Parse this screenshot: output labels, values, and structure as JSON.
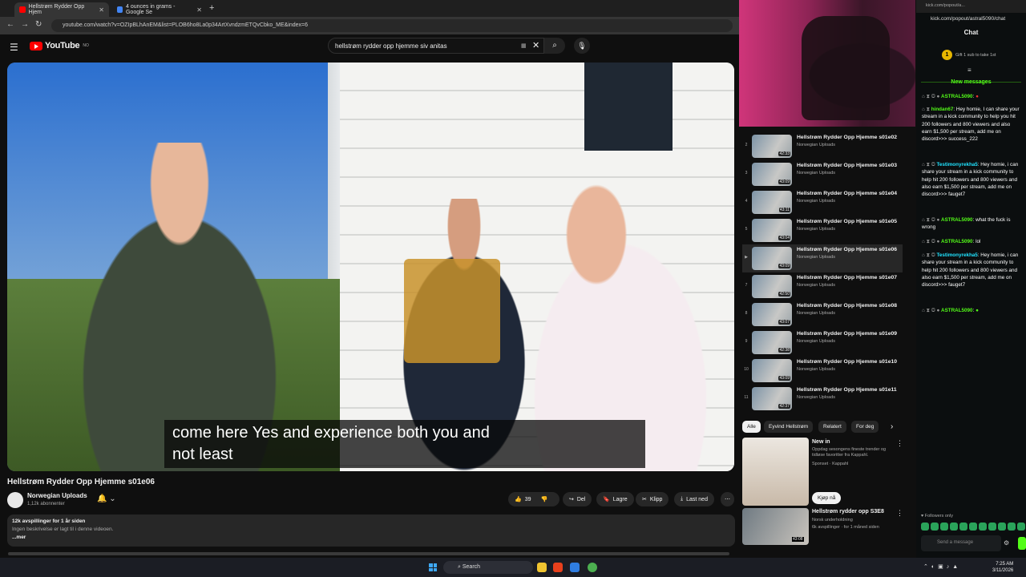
{
  "browser": {
    "tabs": [
      {
        "title": "Hellstrøm Rydder Opp Hjem",
        "active": true
      },
      {
        "title": "4 ounces in grams - Google Se",
        "active": false
      }
    ],
    "url": "youtube.com/watch?v=OZIpBLhAnEM&list=PLOB6ho8La0p34ArtXvndzmETQvCbko_ME&index=6"
  },
  "youtube": {
    "logo_text": "YouTube",
    "logo_region": "NO",
    "search_value": "hellstrøm rydder opp hjemme siv anitas",
    "caption_line1": "come here Yes and experience both you and",
    "caption_line2": "not least",
    "video_title": "Hellstrøm Rydder Opp Hjemme s01e06",
    "channel_name": "Norwegian Uploads",
    "subscribers": "1,12k abonnenter",
    "actions": {
      "likes": "39",
      "share": "Del",
      "save": "Lagre",
      "clip": "Klipp",
      "download": "Last ned"
    },
    "description": {
      "views": "12k avspillinger  for 1 år siden",
      "note": "Ingen beskrivelse er lagt til i denne videoen.",
      "more": "...mer"
    },
    "playlist": [
      {
        "idx": "2",
        "title": "Hellstrøm Rydder Opp Hjemme s01e02",
        "channel": "Norwegian Uploads",
        "duration": "42:33",
        "active": false
      },
      {
        "idx": "3",
        "title": "Hellstrøm Rydder Opp Hjemme s01e03",
        "channel": "Norwegian Uploads",
        "duration": "43:09",
        "active": false
      },
      {
        "idx": "4",
        "title": "Hellstrøm Rydder Opp Hjemme s01e04",
        "channel": "Norwegian Uploads",
        "duration": "43:11",
        "active": false
      },
      {
        "idx": "5",
        "title": "Hellstrøm Rydder Opp Hjemme s01e05",
        "channel": "Norwegian Uploads",
        "duration": "43:04",
        "active": false
      },
      {
        "idx": "▶",
        "title": "Hellstrøm Rydder Opp Hjemme s01e06",
        "channel": "Norwegian Uploads",
        "duration": "43:09",
        "active": true
      },
      {
        "idx": "7",
        "title": "Hellstrøm Rydder Opp Hjemme s01e07",
        "channel": "Norwegian Uploads",
        "duration": "42:50",
        "active": false
      },
      {
        "idx": "8",
        "title": "Hellstrøm Rydder Opp Hjemme s01e08",
        "channel": "Norwegian Uploads",
        "duration": "43:07",
        "active": false
      },
      {
        "idx": "9",
        "title": "Hellstrøm Rydder Opp Hjemme s01e09",
        "channel": "Norwegian Uploads",
        "duration": "42:38",
        "active": false
      },
      {
        "idx": "10",
        "title": "Hellstrøm Rydder Opp Hjemme s01e10",
        "channel": "Norwegian Uploads",
        "duration": "43:09",
        "active": false
      },
      {
        "idx": "11",
        "title": "Hellstrøm Rydder Opp Hjemme s01e11",
        "channel": "Norwegian Uploads",
        "duration": "42:37",
        "active": false
      }
    ],
    "chips": [
      "Alle",
      "Eyvind Hellstrøm",
      "Relatert",
      "For deg"
    ],
    "ad": {
      "title": "New in",
      "desc": "Oppdag sesongens fineste trender og tidløse favoritter fra Kappahl.",
      "sponsor": "Sponset · Kappahl",
      "cta": "Kjøp nå"
    },
    "rec": {
      "title": "Hellstrøm rydder opp S3E8",
      "channel": "Norsk underholdning",
      "meta": "6k avspillinger · for 1 måned siden",
      "duration": "43:08"
    }
  },
  "kick": {
    "tab": "kick.com/popout/a...",
    "url": "kick.com/popout/astral5090/chat",
    "header": "Chat",
    "gift_count": "1",
    "gift_text": "Gift 1 sub to take 1st",
    "new_messages": "New messages",
    "messages": [
      {
        "user": "ASTRAL5090",
        "text": ""
      },
      {
        "user": "hindan67",
        "text": "Hey homie, I can share your stream in a kick community to help you hit 200 followers and 800 viewers and also earn $1,500 per stream, add me on discord>>> success_222"
      },
      {
        "user": "Testimonyrekha5",
        "text": "Hey homie, i can share your stream in a kick community to help hit 200 followers and 800 viewers and also earn $1,500 per stream, add me on discord>>> fauget7"
      },
      {
        "user": "ASTRAL5090",
        "text": "what the fuck is wrong"
      },
      {
        "user": "ASTRAL5090",
        "text": "lol"
      },
      {
        "user": "Testimonyrekha5",
        "text": "Hey homie, i can share your stream in a kick community to help hit 200 followers and 800 viewers and also earn $1,500 per stream, add me on discord>>> fauget7"
      },
      {
        "user": "ASTRAL5090",
        "text": ""
      }
    ],
    "followers_only": "Followers only",
    "input_placeholder": "Send a message"
  },
  "taskbar": {
    "search": "Search",
    "time": "7:25 AM",
    "date": "3/11/2026"
  }
}
